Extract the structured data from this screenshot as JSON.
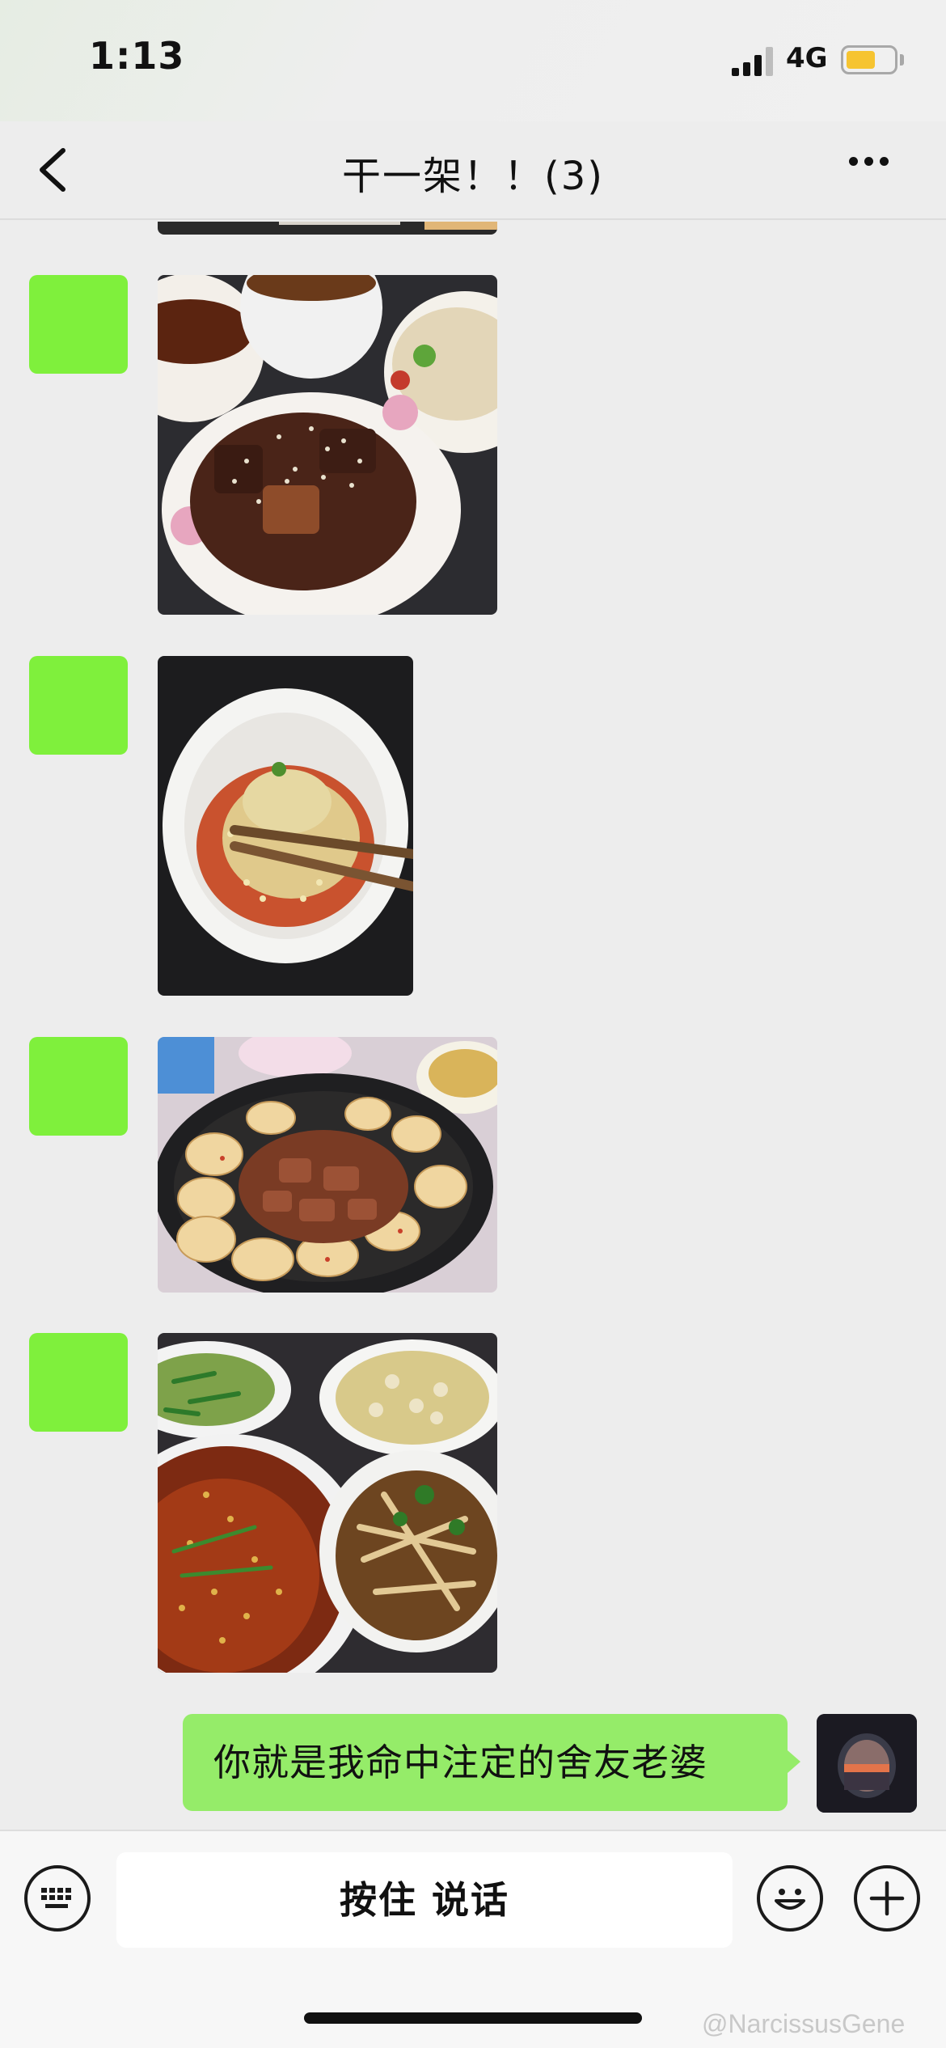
{
  "status_bar": {
    "time": "1:13",
    "network": "4G",
    "battery_level": 0.62,
    "battery_color": "#f6c431"
  },
  "nav": {
    "title": "干一架！！(3)",
    "back_icon": "chevron-left-icon",
    "more_icon": "ellipsis-icon"
  },
  "messages": [
    {
      "sender": "other",
      "type": "image",
      "content": "food photo: braised pork ribs with sesame"
    },
    {
      "sender": "other",
      "type": "image",
      "content": "food photo: chicken held with chopsticks over chili sauce"
    },
    {
      "sender": "other",
      "type": "image",
      "content": "food photo: pan-fried potato slices with pork"
    },
    {
      "sender": "other",
      "type": "image",
      "content": "food photo: table of dishes with chili oil soup"
    },
    {
      "sender": "me",
      "type": "text",
      "text": "你就是我命中注定的舍友老婆"
    }
  ],
  "input_bar": {
    "hold_to_talk": "按住 说话",
    "keyboard_icon": "keyboard-icon",
    "emoji_icon": "emoji-icon",
    "plus_icon": "plus-icon"
  },
  "watermark": "@NarcissusGene",
  "colors": {
    "background": "#ededed",
    "my_bubble": "#95ec69",
    "avatar_placeholder": "#7ff03c"
  }
}
